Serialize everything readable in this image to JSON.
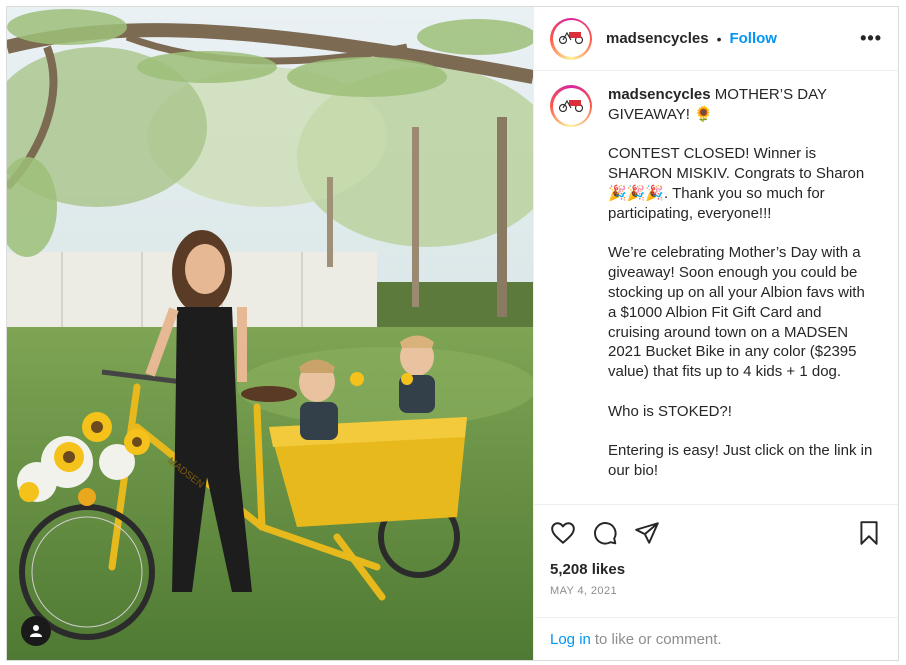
{
  "post": {
    "username": "madsencycles",
    "follow_label": "Follow",
    "separator": "•",
    "more_label": "•••",
    "caption": {
      "username": "madsencycles",
      "text": " MOTHER’S DAY GIVEAWAY! 🌻\n\nCONTEST CLOSED! Winner is SHARON MISKIV. Congrats to Sharon 🎉🎉🎉. Thank you so much for participating, everyone!!!\n\nWe’re celebrating Mother’s Day with a giveaway! Soon enough you could be stocking up on all your Albion favs with a $1000 Albion Fit Gift Card and cruising around town on a MADSEN 2021 Bucket Bike in any color ($2395 value) that fits up to 4 kids + 1 dog.\n\nWho is STOKED?!\n\nEntering is easy! Just click on the link in our bio!"
    },
    "likes": "5,208 likes",
    "date": "MAY 4, 2021",
    "login_link": "Log in",
    "login_rest": "to like or comment.",
    "bike_label": "MADSEN"
  },
  "icons": {
    "like": "heart-icon",
    "comment": "comment-icon",
    "share": "paper-plane-icon",
    "save": "bookmark-icon",
    "tag": "user-tag-icon"
  },
  "colors": {
    "follow": "#0095f6",
    "bike": "#e8b91c",
    "meta": "#8e8e8e"
  }
}
